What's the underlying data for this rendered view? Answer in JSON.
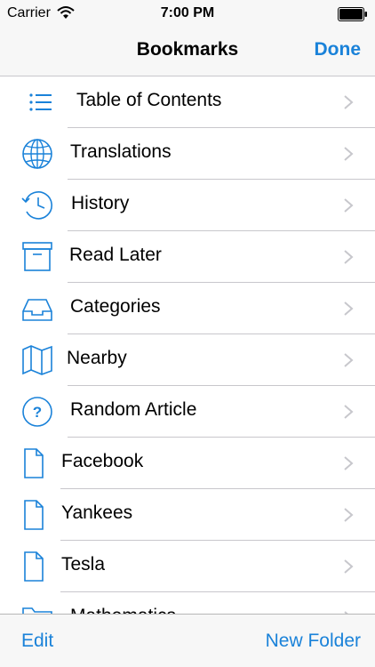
{
  "status_bar": {
    "carrier": "Carrier",
    "time": "7:00 PM"
  },
  "nav": {
    "title": "Bookmarks",
    "done_label": "Done"
  },
  "items": [
    {
      "label": "Table of Contents",
      "icon": "list-icon"
    },
    {
      "label": "Translations",
      "icon": "globe-icon"
    },
    {
      "label": "History",
      "icon": "history-clock-icon"
    },
    {
      "label": "Read Later",
      "icon": "archive-box-icon"
    },
    {
      "label": "Categories",
      "icon": "inbox-tray-icon"
    },
    {
      "label": "Nearby",
      "icon": "map-icon"
    },
    {
      "label": "Random Article",
      "icon": "question-circle-icon"
    },
    {
      "label": "Facebook",
      "icon": "document-icon"
    },
    {
      "label": "Yankees",
      "icon": "document-icon"
    },
    {
      "label": "Tesla",
      "icon": "document-icon"
    },
    {
      "label": "Mathematics",
      "icon": "folder-icon"
    }
  ],
  "toolbar": {
    "edit_label": "Edit",
    "new_folder_label": "New Folder"
  },
  "colors": {
    "accent": "#1a82d9",
    "bar_background": "#f7f7f7",
    "separator": "#c8c7cc"
  }
}
